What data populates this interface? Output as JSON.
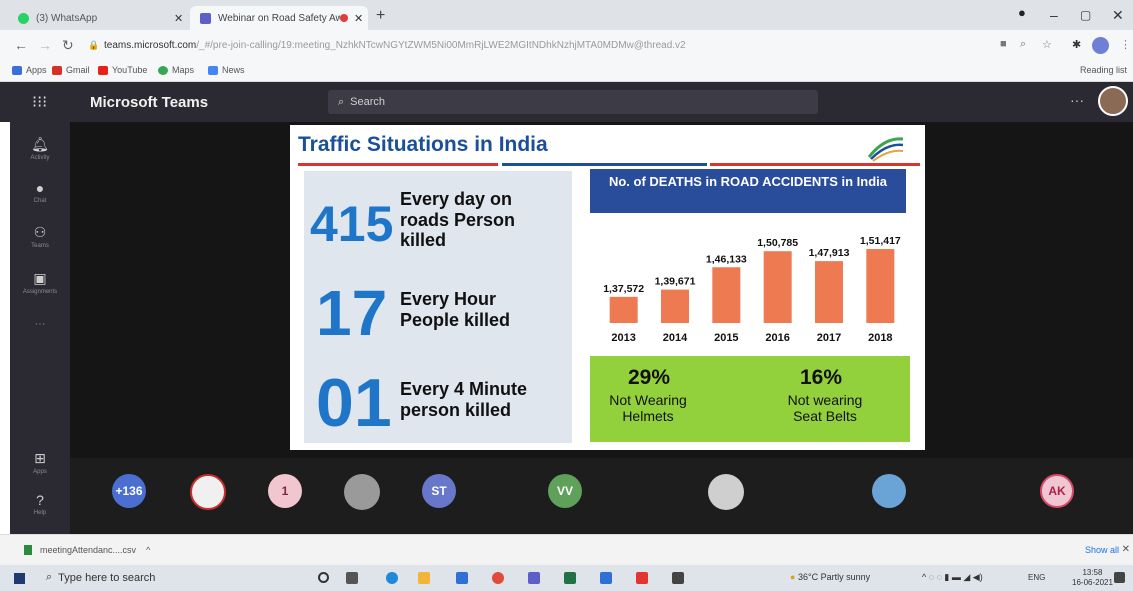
{
  "browser": {
    "tabs": [
      {
        "label": "(3) WhatsApp",
        "active": false
      },
      {
        "label": "Webinar on Road Safety Aw...",
        "active": true
      }
    ],
    "url_host": "teams.microsoft.com",
    "url_path": "/_#/pre-join-calling/19:meeting_NzhkNTcwNGYtZWM5Ni00MmRjLWE2MGItNDhkNzhjMTA0MDMw@thread.v2",
    "bookmarks": [
      "Apps",
      "Gmail",
      "YouTube",
      "Maps",
      "News"
    ],
    "reading_list": "Reading list"
  },
  "teams": {
    "title": "Microsoft Teams",
    "search_placeholder": "Search",
    "rail": [
      "Activity",
      "Chat",
      "Teams",
      "Assignments",
      "Apps",
      "Help"
    ]
  },
  "slide": {
    "title": "Traffic Situations in India",
    "stats": [
      {
        "number": "415",
        "text_lines": [
          "Every day on",
          "roads Person",
          "killed"
        ]
      },
      {
        "number": "17",
        "text_lines": [
          "Every Hour",
          "People killed"
        ]
      },
      {
        "number": "01",
        "text_lines": [
          "Every 4 Minute",
          "person killed"
        ]
      }
    ],
    "helmet_pct": "29%",
    "helmet_label_lines": [
      "Not Wearing",
      "Helmets"
    ],
    "seatbelt_pct": "16%",
    "seatbelt_label_lines": [
      "Not wearing",
      "Seat Belts"
    ]
  },
  "chart_data": {
    "type": "bar",
    "title": "No. of DEATHS in ROAD ACCIDENTS in India",
    "categories": [
      "2013",
      "2014",
      "2015",
      "2016",
      "2017",
      "2018"
    ],
    "values": [
      137572,
      139671,
      146133,
      150785,
      147913,
      151417
    ],
    "data_labels": [
      "1,37,572",
      "1,39,671",
      "1,46,133",
      "1,50,785",
      "1,47,913",
      "1,51,417"
    ],
    "ylim": [
      130000,
      152000
    ],
    "bar_color": "#ee7a52"
  },
  "participants": {
    "overflow_count": "+136",
    "avatars": [
      "",
      "1",
      "",
      "ST",
      "VV",
      "",
      "",
      "AK"
    ],
    "colors": [
      "#4a6fd1",
      "#c9302c",
      "#f2c6cf",
      "#9a9a9a",
      "#6877c9",
      "#5fa05a",
      "#cfcfcf",
      "#6aa3d6",
      "#d94a6a"
    ]
  },
  "downloads": {
    "file": "meetingAttendanc....csv",
    "show_all": "Show all"
  },
  "taskbar": {
    "search_placeholder": "Type here to search",
    "weather": "36°C  Partly sunny",
    "lang": "ENG",
    "time": "13:58",
    "date": "16-06-2021"
  }
}
